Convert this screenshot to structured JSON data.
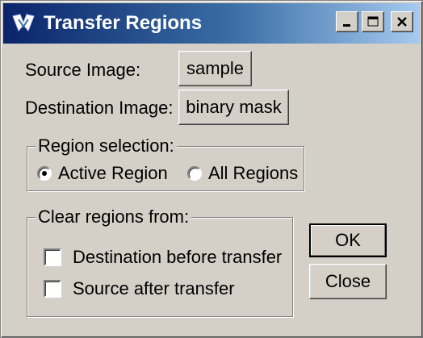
{
  "window": {
    "title": "Transfer Regions"
  },
  "source": {
    "label": "Source Image:",
    "button": "sample"
  },
  "destination": {
    "label": "Destination Image:",
    "button": "binary mask"
  },
  "region_selection": {
    "title": "Region selection:",
    "options": [
      {
        "label": "Active Region",
        "selected": true
      },
      {
        "label": "All Regions",
        "selected": false
      }
    ]
  },
  "clear_regions": {
    "title": "Clear regions from:",
    "options": [
      {
        "label": "Destination before transfer",
        "checked": false
      },
      {
        "label": "Source after transfer",
        "checked": false
      }
    ]
  },
  "buttons": {
    "ok": "OK",
    "close": "Close"
  },
  "icons": {
    "app": "app-logo-icon",
    "minimize": "minimize-icon",
    "maximize": "maximize-icon",
    "close": "close-icon"
  },
  "colors": {
    "titlebar_start": "#0a246a",
    "titlebar_end": "#a6caf0",
    "face": "#d4d0c8"
  }
}
